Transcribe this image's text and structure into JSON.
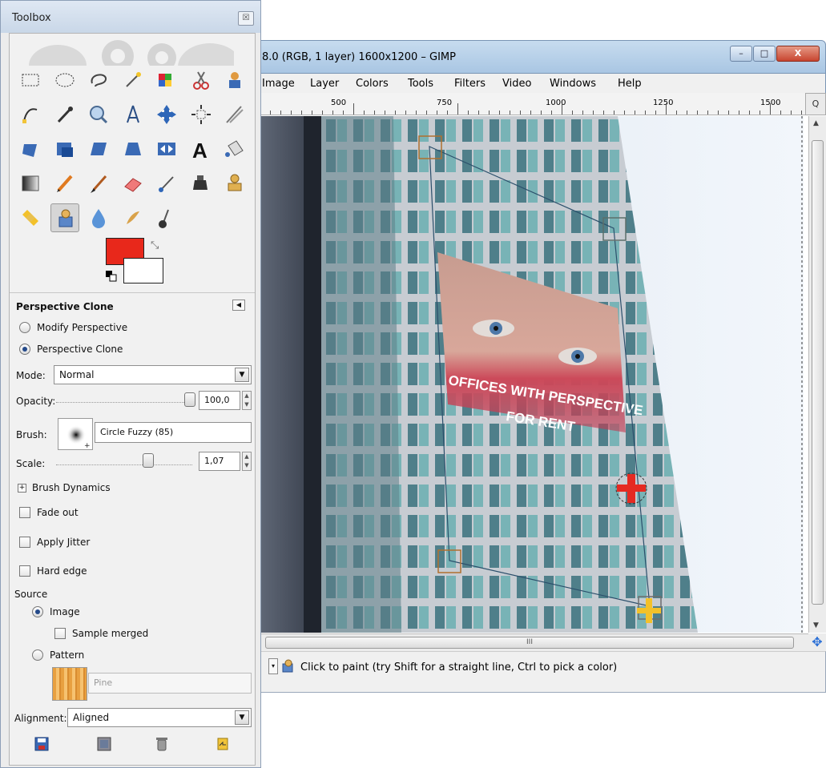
{
  "image_window": {
    "title": "8.0 (RGB, 1 layer) 1600x1200 – GIMP",
    "window_buttons": {
      "minimize": "–",
      "maximize": "□",
      "close": "X"
    },
    "menu": [
      "Image",
      "Layer",
      "Colors",
      "Tools",
      "Filters",
      "Video",
      "Windows",
      "Help"
    ],
    "ruler_labels": [
      "500",
      "750",
      "1000",
      "1250",
      "1500"
    ],
    "zoom_corner": "Q",
    "hscroll_grip": "III",
    "statusbar": {
      "unit_dropdown": "▾",
      "message": "Click to paint (try Shift for a straight line, Ctrl to pick a color)"
    },
    "canvas": {
      "banner_line1": "OFFICES WITH PERSPECTIVE",
      "banner_line2": "FOR RENT"
    }
  },
  "toolbox": {
    "title": "Toolbox",
    "close": "☒",
    "tools": [
      "rect-select-icon",
      "ellipse-select-icon",
      "lasso-icon",
      "fuzzy-select-icon",
      "select-by-color-icon",
      "scissors-icon",
      "foreground-select-icon",
      "paths-icon",
      "color-picker-icon",
      "zoom-icon",
      "measure-icon",
      "move-icon",
      "align-icon",
      "crop-knife-icon",
      "rotate-icon",
      "scale-icon",
      "shear-icon",
      "perspective-icon",
      "flip-icon",
      "text-icon",
      "bucket-fill-icon",
      "blend-icon",
      "pencil-icon",
      "paintbrush-icon",
      "eraser-icon",
      "airbrush-icon",
      "ink-icon",
      "clone-icon",
      "heal-icon",
      "perspective-clone-icon",
      "blur-icon",
      "smudge-icon",
      "dodge-burn-icon"
    ],
    "colors": {
      "foreground": "#e8281b",
      "background": "#ffffff"
    },
    "options": {
      "title": "Perspective Clone",
      "radio_modify": "Modify Perspective",
      "radio_clone": "Perspective Clone",
      "mode_label": "Mode:",
      "mode_value": "Normal",
      "opacity_label": "Opacity:",
      "opacity_value": "100,0",
      "brush_label": "Brush:",
      "brush_value": "Circle Fuzzy (85)",
      "scale_label": "Scale:",
      "scale_value": "1,07",
      "brush_dynamics": "Brush Dynamics",
      "fade_out": "Fade out",
      "apply_jitter": "Apply Jitter",
      "hard_edge": "Hard edge",
      "source_label": "Source",
      "source_image": "Image",
      "sample_merged": "Sample merged",
      "source_pattern": "Pattern",
      "pattern_name": "Pine",
      "alignment_label": "Alignment:",
      "alignment_value": "Aligned"
    }
  }
}
